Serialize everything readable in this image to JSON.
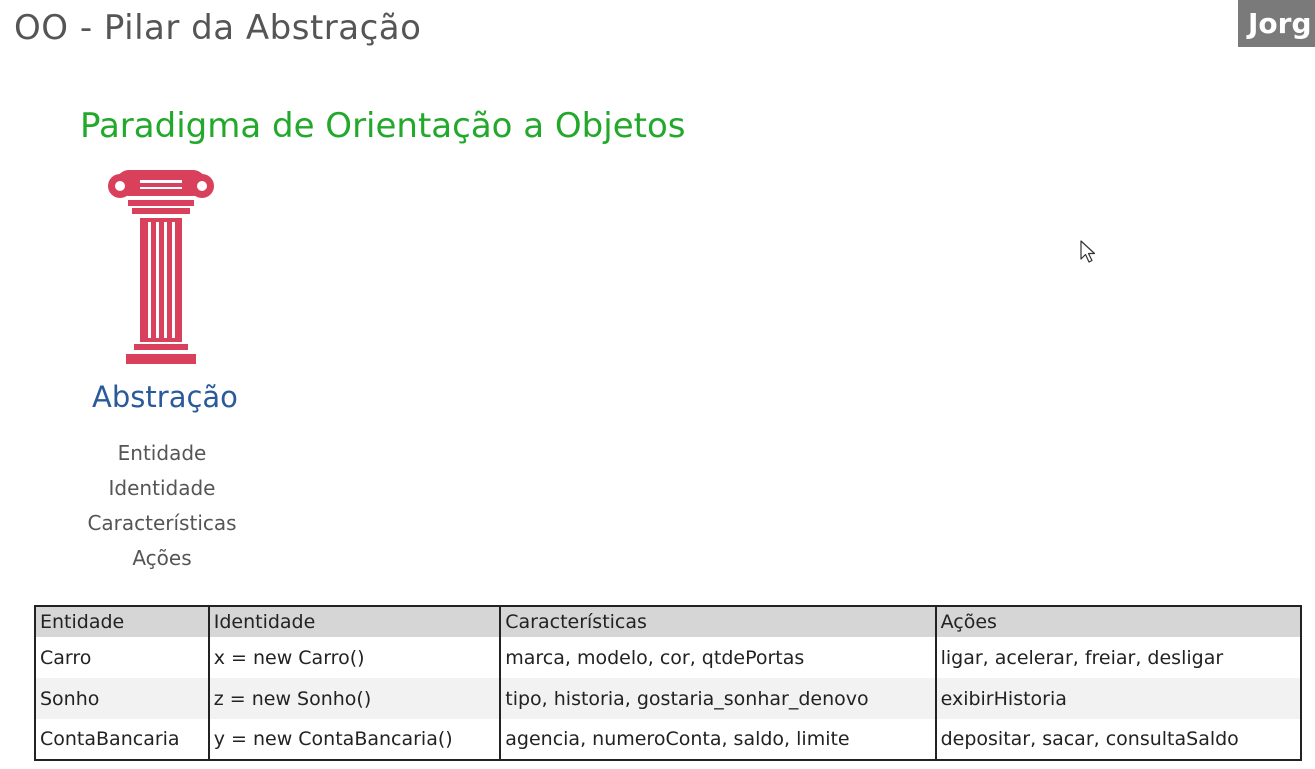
{
  "header": {
    "title": "OO - Pilar da Abstração",
    "presenter_tag": "Jorg"
  },
  "subtitle": "Paradigma de Orientação a Objetos",
  "pillar": {
    "icon": "pillar-icon",
    "color": "#d9405c",
    "label": "Abstração"
  },
  "concepts": [
    "Entidade",
    "Identidade",
    "Características",
    "Ações"
  ],
  "table": {
    "headers": [
      "Entidade",
      "Identidade",
      "Características",
      "Ações"
    ],
    "rows": [
      [
        "Carro",
        "x = new Carro()",
        "marca, modelo, cor, qtdePortas",
        "ligar, acelerar, freiar, desligar"
      ],
      [
        "Sonho",
        "z = new Sonho()",
        "tipo, historia, gostaria_sonhar_denovo",
        "exibirHistoria"
      ],
      [
        "ContaBancaria",
        "y = new ContaBancaria()",
        "agencia, numeroConta, saldo, limite",
        "depositar, sacar, consultaSaldo"
      ]
    ]
  },
  "colors": {
    "subtitle": "#22a82a",
    "pillar_label": "#2a5a9a",
    "header_text": "#555555"
  }
}
